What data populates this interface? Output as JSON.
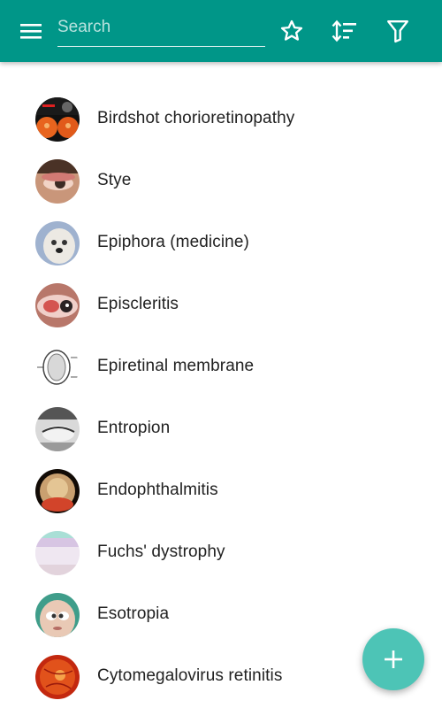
{
  "toolbar": {
    "search_placeholder": "Search",
    "background_color": "#009688",
    "icons": [
      "menu-icon",
      "star-icon",
      "sort-icon",
      "filter-icon"
    ]
  },
  "list": {
    "items": [
      {
        "label": "Birdshot chorioretinopathy"
      },
      {
        "label": "Stye"
      },
      {
        "label": "Epiphora (medicine)"
      },
      {
        "label": "Episcleritis"
      },
      {
        "label": "Epiretinal membrane"
      },
      {
        "label": "Entropion"
      },
      {
        "label": "Endophthalmitis"
      },
      {
        "label": "Fuchs' dystrophy"
      },
      {
        "label": "Esotropia"
      },
      {
        "label": "Cytomegalovirus retinitis"
      }
    ]
  },
  "fab": {
    "icon": "plus-icon",
    "color": "#4dc4b6"
  }
}
